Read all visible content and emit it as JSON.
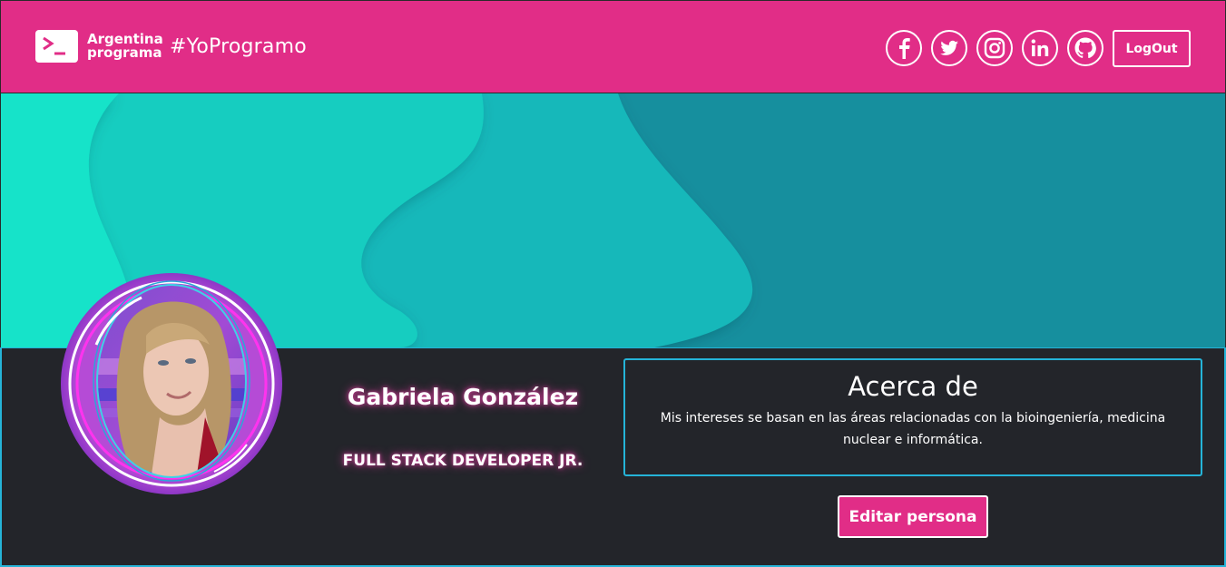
{
  "header": {
    "brand_line1": "Argentina",
    "brand_line2": "programa",
    "hashtag": "#YoProgramo",
    "logout_label": "LogOut",
    "social_icons": [
      "facebook-icon",
      "twitter-icon",
      "instagram-icon",
      "linkedin-icon",
      "github-icon"
    ]
  },
  "profile": {
    "name": "Gabriela González",
    "role": "FULL STACK DEVELOPER JR."
  },
  "about": {
    "title": "Acerca de",
    "text": "Mis intereses se basan en las áreas relacionadas con la bioingeniería, medicina nuclear e informática."
  },
  "actions": {
    "edit_label": "Editar persona"
  },
  "colors": {
    "header_bg": "#e12d87",
    "accent_border": "#25b4d8",
    "section_bg": "#23252a",
    "banner_light": "#14e6c8",
    "banner_dark": "#168f9e"
  }
}
